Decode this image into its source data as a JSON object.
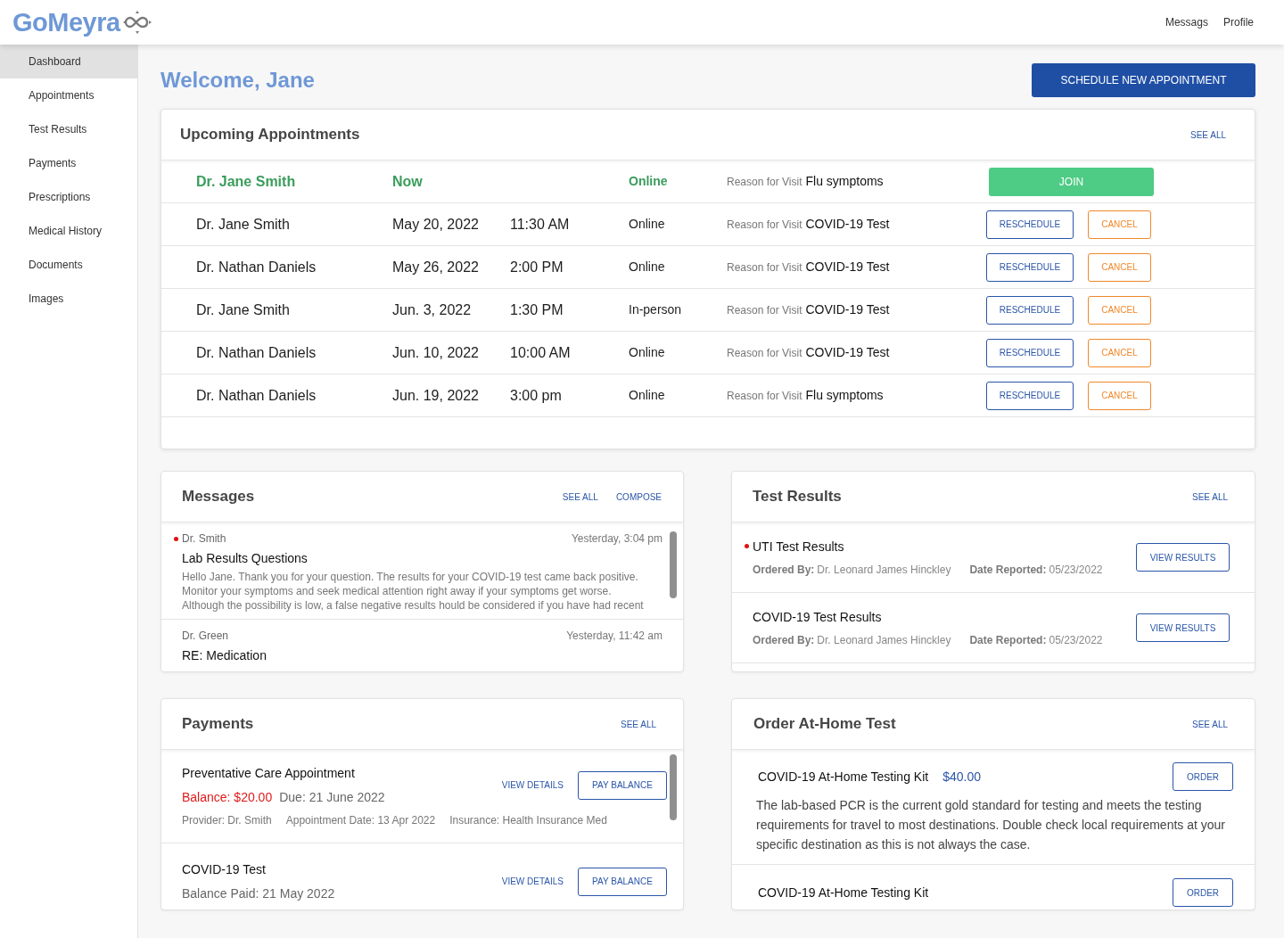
{
  "header": {
    "logo": "GoMeyra",
    "nav": [
      {
        "label": "Messags"
      },
      {
        "label": "Profile"
      }
    ]
  },
  "sidebar": {
    "items": [
      {
        "label": "Dashboard",
        "selected": true
      },
      {
        "label": "Appointments",
        "selected": false
      },
      {
        "label": "Test Results",
        "selected": false
      },
      {
        "label": "Payments",
        "selected": false
      },
      {
        "label": "Prescriptions",
        "selected": false
      },
      {
        "label": "Medical History",
        "selected": false
      },
      {
        "label": "Documents",
        "selected": false
      },
      {
        "label": "Images",
        "selected": false
      }
    ]
  },
  "welcome": {
    "title": "Welcome, Jane",
    "button": "SCHEDULE NEW APPOINTMENT"
  },
  "appointments": {
    "title": "Upcoming Appointments",
    "see_all": "SEE ALL",
    "rows": [
      {
        "kind": "current",
        "doctor": "Dr. Jane Smith",
        "date": "Now",
        "mode": "Online",
        "reason_label": "Reason for Visit",
        "reason": "Flu symptoms",
        "actions": [
          {
            "kind": "join",
            "label": "JOIN"
          }
        ]
      },
      {
        "kind": "scheduled",
        "doctor": "Dr. Jane Smith",
        "date": "May 20, 2022",
        "time": "11:30 AM",
        "mode": "Online",
        "reason_label": "Reason for Visit",
        "reason": "COVID-19 Test",
        "actions": [
          {
            "kind": "reschedule",
            "label": "RESCHEDULE"
          },
          {
            "kind": "cancel",
            "label": "CANCEL"
          }
        ]
      },
      {
        "kind": "scheduled",
        "doctor": "Dr. Nathan Daniels",
        "date": "May 26, 2022",
        "time": "2:00 PM",
        "mode": "Online",
        "reason_label": "Reason for Visit",
        "reason": "COVID-19 Test",
        "actions": [
          {
            "kind": "reschedule",
            "label": "RESCHEDULE"
          },
          {
            "kind": "cancel",
            "label": "CANCEL"
          }
        ]
      },
      {
        "kind": "scheduled",
        "doctor": "Dr. Jane Smith",
        "date": "Jun. 3, 2022",
        "time": "1:30 PM",
        "mode": "In-person",
        "reason_label": "Reason for Visit",
        "reason": "COVID-19 Test",
        "actions": [
          {
            "kind": "reschedule",
            "label": "RESCHEDULE"
          },
          {
            "kind": "cancel",
            "label": "CANCEL"
          }
        ]
      },
      {
        "kind": "scheduled",
        "doctor": "Dr. Nathan Daniels",
        "date": "Jun. 10, 2022",
        "time": "10:00 AM",
        "mode": "Online",
        "reason_label": "Reason for Visit",
        "reason": "COVID-19 Test",
        "actions": [
          {
            "kind": "reschedule",
            "label": "RESCHEDULE"
          },
          {
            "kind": "cancel",
            "label": "CANCEL"
          }
        ]
      },
      {
        "kind": "scheduled",
        "doctor": "Dr. Nathan Daniels",
        "date": "Jun. 19, 2022",
        "time": "3:00 pm",
        "mode": "Online",
        "reason_label": "Reason for Visit",
        "reason": "Flu symptoms",
        "actions": [
          {
            "kind": "reschedule",
            "label": "RESCHEDULE"
          },
          {
            "kind": "cancel",
            "label": "CANCEL"
          }
        ]
      }
    ]
  },
  "messages": {
    "title": "Messages",
    "links": [
      "SEE ALL",
      "COMPOSE"
    ],
    "items": [
      {
        "unread": true,
        "sender": "Dr. Smith",
        "time": "Yesterday, 3:04 pm",
        "subject": "Lab Results Questions",
        "body": "Hello Jane. Thank you for your question. The results for your COVID-19 test came back positive. Monitor your symptoms and seek medical attention right away if your symptoms get worse. Although the possibility is low, a false negative results hould be considered if you have had recent"
      },
      {
        "unread": false,
        "sender": "Dr. Green",
        "time": "Yesterday, 11:42 am",
        "subject": "RE: Medication"
      }
    ]
  },
  "test_results": {
    "title": "Test Results",
    "see_all": "SEE ALL",
    "items": [
      {
        "unread": true,
        "name": "UTI Test Results",
        "ordered_by_label": "Ordered By:",
        "ordered_by": "Dr. Leonard James Hinckley",
        "date_label": "Date Reported:",
        "date": "05/23/2022",
        "button": "VIEW RESULTS"
      },
      {
        "unread": false,
        "name": "COVID-19 Test Results",
        "ordered_by_label": "Ordered By:",
        "ordered_by": "Dr. Leonard James Hinckley",
        "date_label": "Date Reported:",
        "date": "05/23/2022",
        "button": "VIEW RESULTS"
      }
    ]
  },
  "payments": {
    "title": "Payments",
    "see_all": "SEE ALL",
    "items": [
      {
        "kind": "due",
        "title": "Preventative Care Appointment",
        "balance": "Balance: $20.00",
        "due": "Due: 21 June 2022",
        "details": [
          "Provider: Dr. Smith",
          "Appointment Date: 13 Apr 2022",
          "Insurance: Health Insurance Med"
        ],
        "link": "VIEW DETAILS",
        "button": "PAY BALANCE"
      },
      {
        "kind": "paid",
        "title": "COVID-19 Test",
        "paid": "Balance Paid: 21 May 2022",
        "link": "VIEW DETAILS",
        "button": "PAY BALANCE"
      }
    ]
  },
  "order_test": {
    "title": "Order At-Home Test",
    "see_all": "SEE ALL",
    "items": [
      {
        "name": "COVID-19 At-Home Testing Kit",
        "price": "$40.00",
        "description": "The lab-based PCR is the current gold standard for testing and meets the testing requirements for travel to most destinations. Double check local requirements at your specific destination as this is not always the case.",
        "button": "ORDER"
      },
      {
        "name": "COVID-19 At-Home Testing Kit",
        "button": "ORDER"
      }
    ]
  }
}
